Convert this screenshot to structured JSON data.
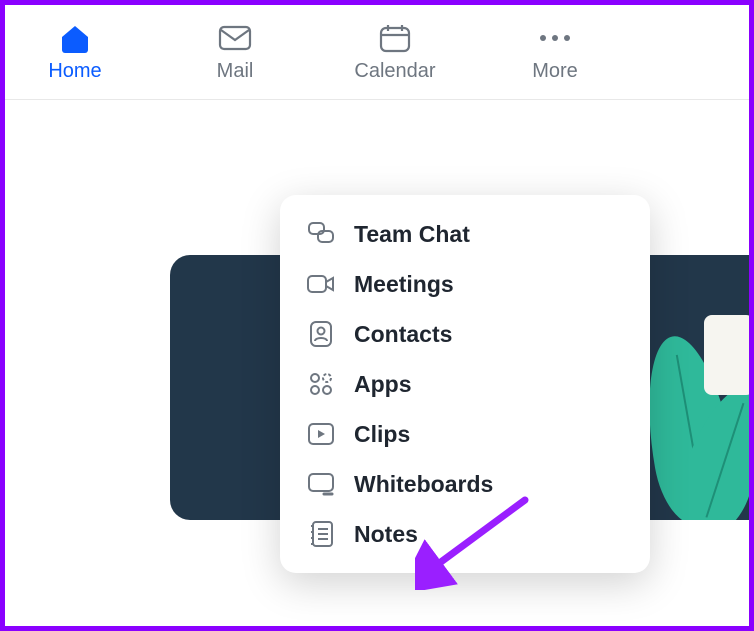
{
  "nav": {
    "items": [
      {
        "label": "Home",
        "icon": "home-icon",
        "active": true
      },
      {
        "label": "Mail",
        "icon": "mail-icon",
        "active": false
      },
      {
        "label": "Calendar",
        "icon": "calendar-icon",
        "active": false
      },
      {
        "label": "More",
        "icon": "more-icon",
        "active": false
      }
    ]
  },
  "more_menu": {
    "items": [
      {
        "label": "Team Chat",
        "icon": "chat-icon"
      },
      {
        "label": "Meetings",
        "icon": "video-icon"
      },
      {
        "label": "Contacts",
        "icon": "contact-icon"
      },
      {
        "label": "Apps",
        "icon": "apps-icon"
      },
      {
        "label": "Clips",
        "icon": "clips-icon"
      },
      {
        "label": "Whiteboards",
        "icon": "whiteboard-icon"
      },
      {
        "label": "Notes",
        "icon": "notes-icon"
      }
    ]
  },
  "annotation": {
    "arrow_color": "#9a1fff",
    "target": "Notes"
  },
  "colors": {
    "accent": "#0b5cff",
    "muted": "#6e7680",
    "text": "#1f2630",
    "banner_bg": "#22374a",
    "plant": "#2fb99a",
    "frame_border": "#8a00ff"
  }
}
